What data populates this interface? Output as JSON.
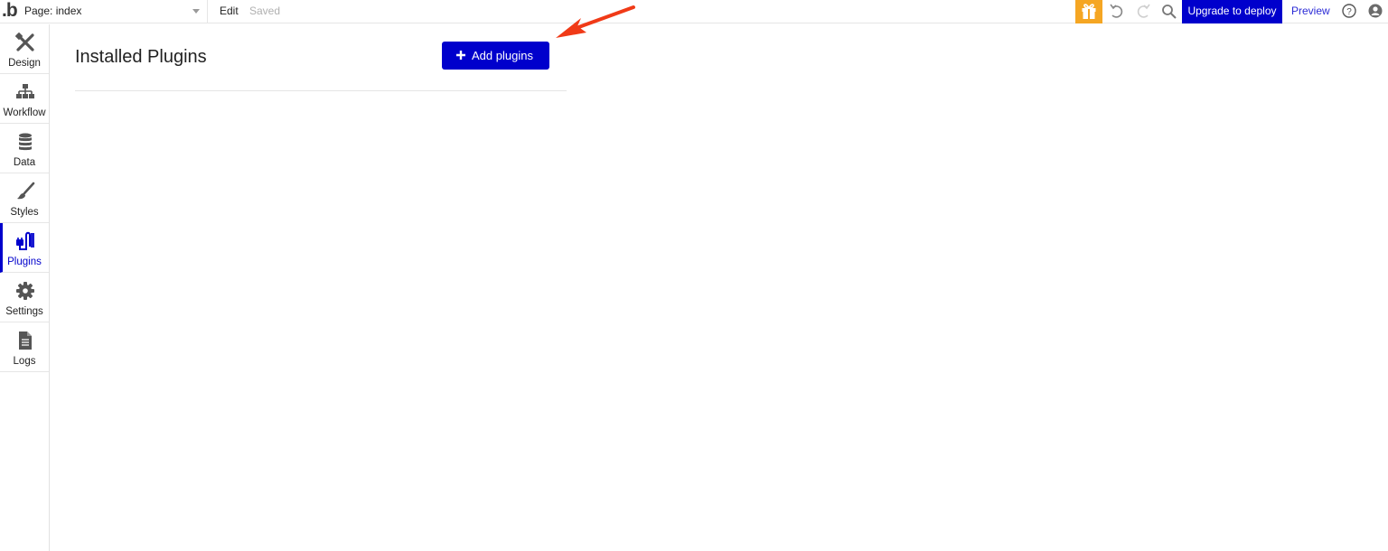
{
  "app": {
    "logo_text": ".b",
    "page_selector": {
      "label": "Page: index"
    },
    "edit_label": "Edit",
    "status_label": "Saved"
  },
  "toolbar": {
    "gift_icon": "gift-icon",
    "undo_icon": "undo-icon",
    "redo_icon": "redo-icon",
    "search_icon": "search-icon",
    "upgrade_label": "Upgrade to deploy",
    "preview_label": "Preview",
    "help_icon": "help-icon",
    "account_icon": "user-icon",
    "accent_color": "#0000cc",
    "gift_color": "#f5a623"
  },
  "sidebar": {
    "items": [
      {
        "label": "Design",
        "icon": "design-icon",
        "active": false
      },
      {
        "label": "Workflow",
        "icon": "workflow-icon",
        "active": false
      },
      {
        "label": "Data",
        "icon": "database-icon",
        "active": false
      },
      {
        "label": "Styles",
        "icon": "brush-icon",
        "active": false
      },
      {
        "label": "Plugins",
        "icon": "plugin-icon",
        "active": true
      },
      {
        "label": "Settings",
        "icon": "gear-icon",
        "active": false
      },
      {
        "label": "Logs",
        "icon": "document-icon",
        "active": false
      }
    ]
  },
  "main": {
    "title": "Installed Plugins",
    "add_button_label": "Add plugins",
    "annotation_color": "#f03a17"
  }
}
